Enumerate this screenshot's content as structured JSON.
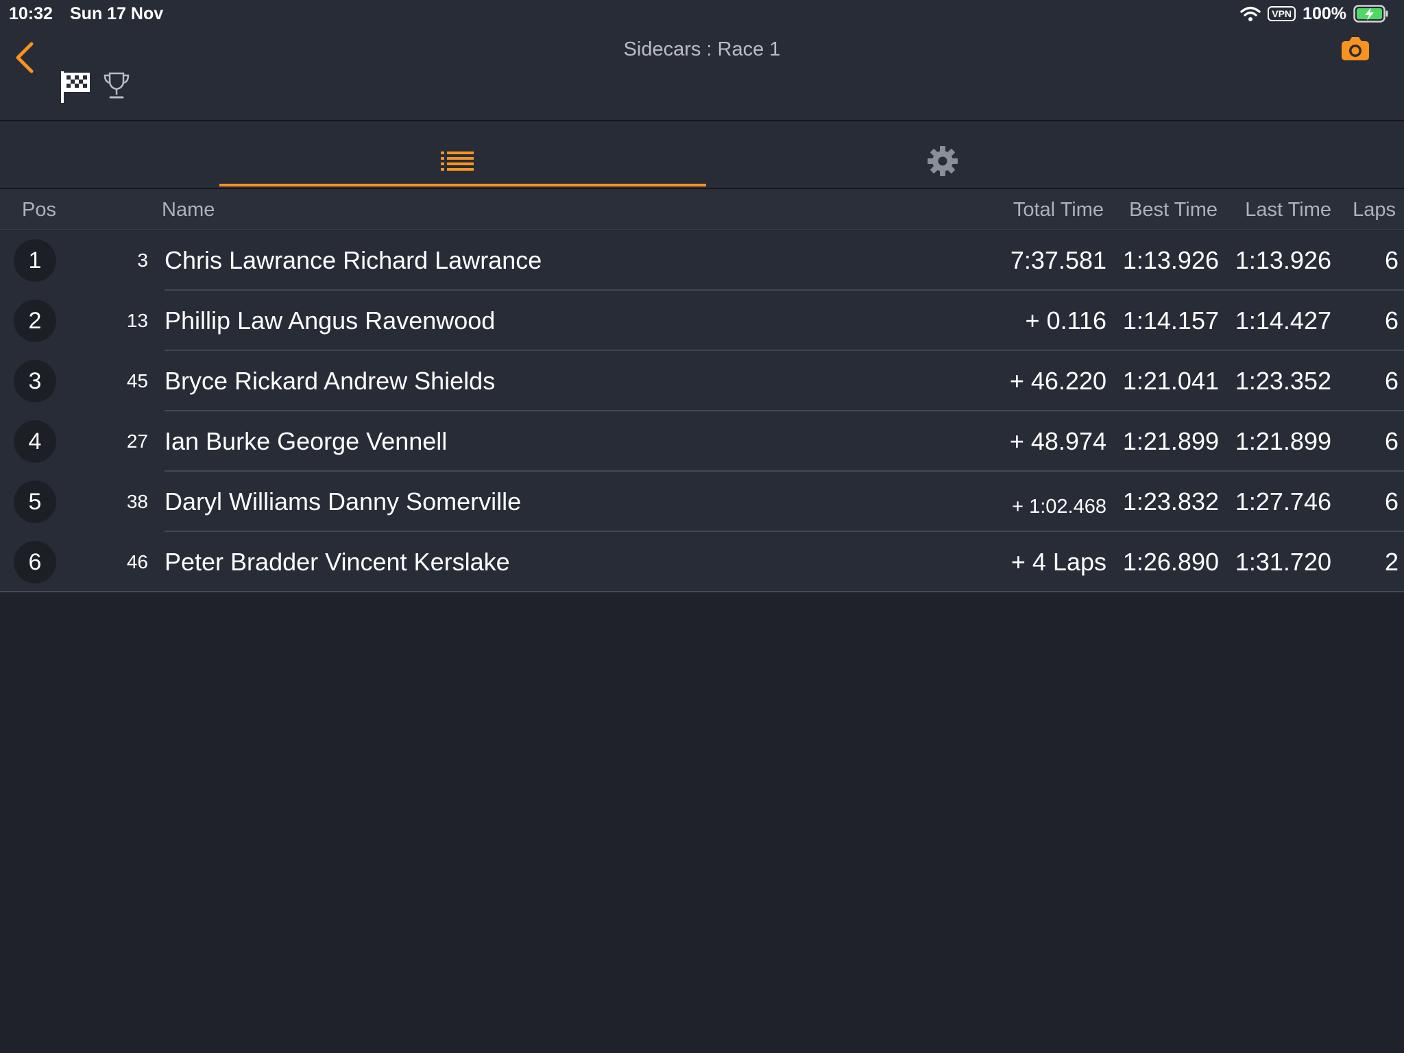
{
  "status_bar": {
    "time": "10:32",
    "date": "Sun 17 Nov",
    "vpn": "VPN",
    "battery": "100%",
    "icons": [
      "wifi-icon",
      "vpn-badge",
      "battery-charging-icon"
    ]
  },
  "header": {
    "title": "Sidecars : Race 1",
    "icons": [
      "back-chevron-icon",
      "checkered-flag-icon",
      "trophy-icon",
      "camera-icon"
    ]
  },
  "tabs": [
    {
      "icon": "list-icon",
      "active": true
    },
    {
      "icon": "gear-icon",
      "active": false
    }
  ],
  "colors": {
    "accent": "#f7931e",
    "background": "#1f222b",
    "panel": "#282c37"
  },
  "table": {
    "columns": {
      "pos": "Pos",
      "name": "Name",
      "total": "Total Time",
      "best": "Best Time",
      "last": "Last Time",
      "laps": "Laps"
    },
    "rows": [
      {
        "pos": "1",
        "number": "3",
        "name": "Chris Lawrance Richard Lawrance",
        "total": "7:37.581",
        "best": "1:13.926",
        "last": "1:13.926",
        "laps": "6"
      },
      {
        "pos": "2",
        "number": "13",
        "name": "Phillip Law Angus Ravenwood",
        "total": "+ 0.116",
        "best": "1:14.157",
        "last": "1:14.427",
        "laps": "6"
      },
      {
        "pos": "3",
        "number": "45",
        "name": "Bryce Rickard Andrew Shields",
        "total": "+ 46.220",
        "best": "1:21.041",
        "last": "1:23.352",
        "laps": "6"
      },
      {
        "pos": "4",
        "number": "27",
        "name": "Ian Burke George Vennell",
        "total": "+ 48.974",
        "best": "1:21.899",
        "last": "1:21.899",
        "laps": "6"
      },
      {
        "pos": "5",
        "number": "38",
        "name": "Daryl Williams Danny Somerville",
        "total": "+ 1:02.468",
        "best": "1:23.832",
        "last": "1:27.746",
        "laps": "6"
      },
      {
        "pos": "6",
        "number": "46",
        "name": "Peter Bradder Vincent Kerslake",
        "total": "+ 4 Laps",
        "best": "1:26.890",
        "last": "1:31.720",
        "laps": "2"
      }
    ]
  }
}
